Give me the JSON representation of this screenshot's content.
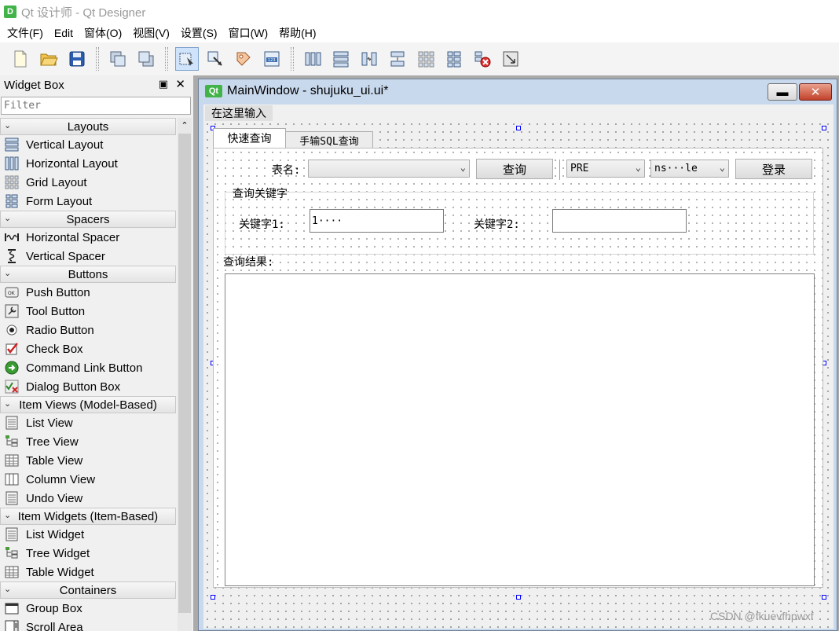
{
  "app": {
    "icon_text": "D",
    "title": "Qt 设计师 - Qt Designer"
  },
  "menubar": {
    "items": [
      "文件(F)",
      "Edit",
      "窗体(O)",
      "视图(V)",
      "设置(S)",
      "窗口(W)",
      "帮助(H)"
    ]
  },
  "toolbar": {
    "icons": [
      "new-file-icon",
      "open-folder-icon",
      "save-icon",
      "bring-to-front-icon",
      "send-to-back-icon",
      "edit-widgets-icon",
      "edit-signals-slots-icon",
      "edit-buddies-icon",
      "edit-tab-order-icon",
      "layout-horizontal-icon",
      "layout-vertical-icon",
      "layout-horizontal-splitter-icon",
      "layout-vertical-splitter-icon",
      "layout-grid-icon",
      "layout-form-icon",
      "break-layout-icon",
      "adjust-size-icon"
    ]
  },
  "widget_box": {
    "title": "Widget Box",
    "float_symbol": "▣",
    "close_symbol": "✕",
    "filter_placeholder": "Filter",
    "groups": [
      {
        "label": "Layouts",
        "items": [
          {
            "label": "Vertical Layout",
            "icon": "vertical-layout-icon"
          },
          {
            "label": "Horizontal Layout",
            "icon": "horizontal-layout-icon"
          },
          {
            "label": "Grid Layout",
            "icon": "grid-layout-icon"
          },
          {
            "label": "Form Layout",
            "icon": "form-layout-icon"
          }
        ]
      },
      {
        "label": "Spacers",
        "items": [
          {
            "label": "Horizontal Spacer",
            "icon": "horizontal-spacer-icon"
          },
          {
            "label": "Vertical Spacer",
            "icon": "vertical-spacer-icon"
          }
        ]
      },
      {
        "label": "Buttons",
        "items": [
          {
            "label": "Push Button",
            "icon": "push-button-icon"
          },
          {
            "label": "Tool Button",
            "icon": "tool-button-icon"
          },
          {
            "label": "Radio Button",
            "icon": "radio-button-icon"
          },
          {
            "label": "Check Box",
            "icon": "check-box-icon"
          },
          {
            "label": "Command Link Button",
            "icon": "command-link-icon"
          },
          {
            "label": "Dialog Button Box",
            "icon": "dialog-button-box-icon"
          }
        ]
      },
      {
        "label": "Item Views (Model-Based)",
        "items": [
          {
            "label": "List View",
            "icon": "list-view-icon"
          },
          {
            "label": "Tree View",
            "icon": "tree-view-icon"
          },
          {
            "label": "Table View",
            "icon": "table-view-icon"
          },
          {
            "label": "Column View",
            "icon": "column-view-icon"
          },
          {
            "label": "Undo View",
            "icon": "undo-view-icon"
          }
        ]
      },
      {
        "label": "Item Widgets (Item-Based)",
        "items": [
          {
            "label": "List Widget",
            "icon": "list-widget-icon"
          },
          {
            "label": "Tree Widget",
            "icon": "tree-widget-icon"
          },
          {
            "label": "Table Widget",
            "icon": "table-widget-icon"
          }
        ]
      },
      {
        "label": "Containers",
        "items": [
          {
            "label": "Group Box",
            "icon": "group-box-icon"
          },
          {
            "label": "Scroll Area",
            "icon": "scroll-area-icon"
          }
        ]
      }
    ]
  },
  "subwindow": {
    "icon_text": "Qt",
    "title": "MainWindow - shujuku_ui.ui*",
    "minimize_symbol": "▬",
    "close_symbol": "✕"
  },
  "form": {
    "menu_hint": "在这里输入",
    "tabs": [
      "快速查询",
      "手输SQL查询"
    ],
    "table_label": "表名:",
    "table_combo_value": "",
    "query_button": "查询",
    "db_combo_value": "PRE",
    "schema_combo_value": "ns···le",
    "login_button": "登录",
    "group_title": "查询关键字",
    "keyword1_label": "关键字1:",
    "keyword1_value": "1····",
    "keyword2_label": "关键字2:",
    "keyword2_value": "",
    "result_label": "查询结果:"
  },
  "watermark": "CSDN @fkuevfhpwxf"
}
